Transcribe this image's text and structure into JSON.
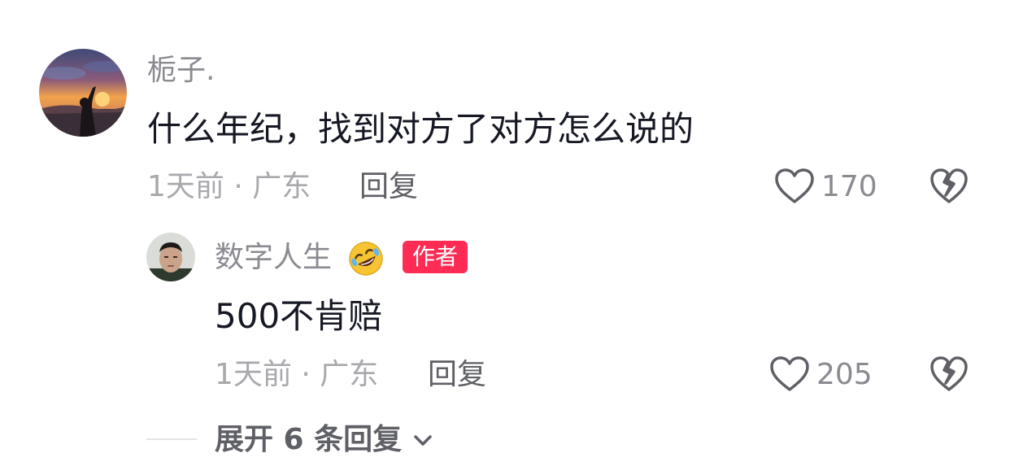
{
  "comment": {
    "username": "栀子.",
    "text": "什么年纪，找到对方了对方怎么说的",
    "time_location": "1天前 · 广东",
    "reply_label": "回复",
    "likes": "170"
  },
  "reply": {
    "username": "数字人生",
    "emoji": "🤣",
    "badge": "作者",
    "text": "500不肯赔",
    "time_location": "1天前 · 广东",
    "reply_label": "回复",
    "likes": "205"
  },
  "expand": {
    "label": "展开 6 条回复"
  },
  "colors": {
    "accent": "#fe2c55",
    "text_primary": "#161823",
    "text_secondary": "#8a8b91"
  }
}
